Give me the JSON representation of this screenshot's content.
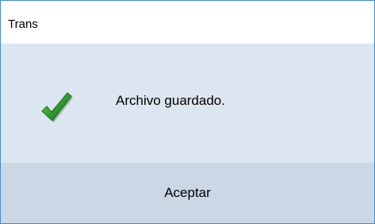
{
  "window": {
    "title": "Trans"
  },
  "dialog": {
    "icon": "checkmark-icon",
    "message": "Archivo guardado."
  },
  "footer": {
    "ok_label": "Aceptar"
  },
  "colors": {
    "border": "#3c8dd6",
    "body_bg": "#dce6f0",
    "footer_bg": "#cbd7e4",
    "check_green": "#2e9d2e"
  }
}
